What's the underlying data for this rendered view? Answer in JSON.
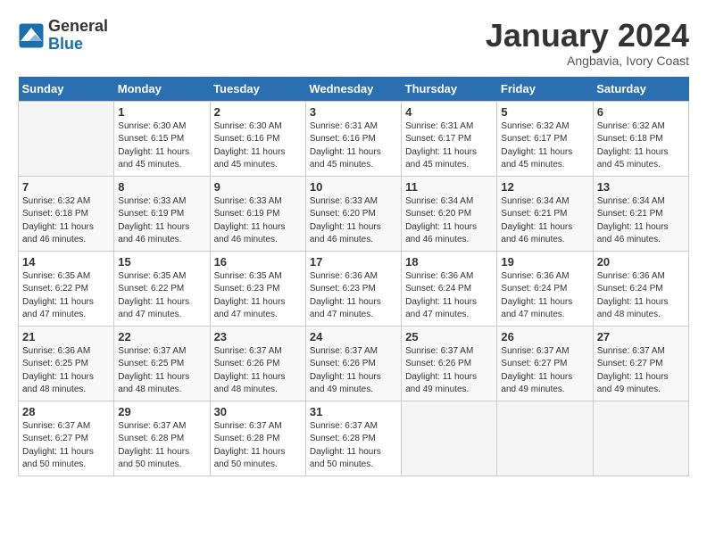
{
  "header": {
    "logo_line1": "General",
    "logo_line2": "Blue",
    "month": "January 2024",
    "location": "Angbavia, Ivory Coast"
  },
  "days_of_week": [
    "Sunday",
    "Monday",
    "Tuesday",
    "Wednesday",
    "Thursday",
    "Friday",
    "Saturday"
  ],
  "weeks": [
    [
      {
        "day": "",
        "info": ""
      },
      {
        "day": "1",
        "info": "Sunrise: 6:30 AM\nSunset: 6:15 PM\nDaylight: 11 hours\nand 45 minutes."
      },
      {
        "day": "2",
        "info": "Sunrise: 6:30 AM\nSunset: 6:16 PM\nDaylight: 11 hours\nand 45 minutes."
      },
      {
        "day": "3",
        "info": "Sunrise: 6:31 AM\nSunset: 6:16 PM\nDaylight: 11 hours\nand 45 minutes."
      },
      {
        "day": "4",
        "info": "Sunrise: 6:31 AM\nSunset: 6:17 PM\nDaylight: 11 hours\nand 45 minutes."
      },
      {
        "day": "5",
        "info": "Sunrise: 6:32 AM\nSunset: 6:17 PM\nDaylight: 11 hours\nand 45 minutes."
      },
      {
        "day": "6",
        "info": "Sunrise: 6:32 AM\nSunset: 6:18 PM\nDaylight: 11 hours\nand 45 minutes."
      }
    ],
    [
      {
        "day": "7",
        "info": "Sunrise: 6:32 AM\nSunset: 6:18 PM\nDaylight: 11 hours\nand 46 minutes."
      },
      {
        "day": "8",
        "info": "Sunrise: 6:33 AM\nSunset: 6:19 PM\nDaylight: 11 hours\nand 46 minutes."
      },
      {
        "day": "9",
        "info": "Sunrise: 6:33 AM\nSunset: 6:19 PM\nDaylight: 11 hours\nand 46 minutes."
      },
      {
        "day": "10",
        "info": "Sunrise: 6:33 AM\nSunset: 6:20 PM\nDaylight: 11 hours\nand 46 minutes."
      },
      {
        "day": "11",
        "info": "Sunrise: 6:34 AM\nSunset: 6:20 PM\nDaylight: 11 hours\nand 46 minutes."
      },
      {
        "day": "12",
        "info": "Sunrise: 6:34 AM\nSunset: 6:21 PM\nDaylight: 11 hours\nand 46 minutes."
      },
      {
        "day": "13",
        "info": "Sunrise: 6:34 AM\nSunset: 6:21 PM\nDaylight: 11 hours\nand 46 minutes."
      }
    ],
    [
      {
        "day": "14",
        "info": "Sunrise: 6:35 AM\nSunset: 6:22 PM\nDaylight: 11 hours\nand 47 minutes."
      },
      {
        "day": "15",
        "info": "Sunrise: 6:35 AM\nSunset: 6:22 PM\nDaylight: 11 hours\nand 47 minutes."
      },
      {
        "day": "16",
        "info": "Sunrise: 6:35 AM\nSunset: 6:23 PM\nDaylight: 11 hours\nand 47 minutes."
      },
      {
        "day": "17",
        "info": "Sunrise: 6:36 AM\nSunset: 6:23 PM\nDaylight: 11 hours\nand 47 minutes."
      },
      {
        "day": "18",
        "info": "Sunrise: 6:36 AM\nSunset: 6:24 PM\nDaylight: 11 hours\nand 47 minutes."
      },
      {
        "day": "19",
        "info": "Sunrise: 6:36 AM\nSunset: 6:24 PM\nDaylight: 11 hours\nand 47 minutes."
      },
      {
        "day": "20",
        "info": "Sunrise: 6:36 AM\nSunset: 6:24 PM\nDaylight: 11 hours\nand 48 minutes."
      }
    ],
    [
      {
        "day": "21",
        "info": "Sunrise: 6:36 AM\nSunset: 6:25 PM\nDaylight: 11 hours\nand 48 minutes."
      },
      {
        "day": "22",
        "info": "Sunrise: 6:37 AM\nSunset: 6:25 PM\nDaylight: 11 hours\nand 48 minutes."
      },
      {
        "day": "23",
        "info": "Sunrise: 6:37 AM\nSunset: 6:26 PM\nDaylight: 11 hours\nand 48 minutes."
      },
      {
        "day": "24",
        "info": "Sunrise: 6:37 AM\nSunset: 6:26 PM\nDaylight: 11 hours\nand 49 minutes."
      },
      {
        "day": "25",
        "info": "Sunrise: 6:37 AM\nSunset: 6:26 PM\nDaylight: 11 hours\nand 49 minutes."
      },
      {
        "day": "26",
        "info": "Sunrise: 6:37 AM\nSunset: 6:27 PM\nDaylight: 11 hours\nand 49 minutes."
      },
      {
        "day": "27",
        "info": "Sunrise: 6:37 AM\nSunset: 6:27 PM\nDaylight: 11 hours\nand 49 minutes."
      }
    ],
    [
      {
        "day": "28",
        "info": "Sunrise: 6:37 AM\nSunset: 6:27 PM\nDaylight: 11 hours\nand 50 minutes."
      },
      {
        "day": "29",
        "info": "Sunrise: 6:37 AM\nSunset: 6:28 PM\nDaylight: 11 hours\nand 50 minutes."
      },
      {
        "day": "30",
        "info": "Sunrise: 6:37 AM\nSunset: 6:28 PM\nDaylight: 11 hours\nand 50 minutes."
      },
      {
        "day": "31",
        "info": "Sunrise: 6:37 AM\nSunset: 6:28 PM\nDaylight: 11 hours\nand 50 minutes."
      },
      {
        "day": "",
        "info": ""
      },
      {
        "day": "",
        "info": ""
      },
      {
        "day": "",
        "info": ""
      }
    ]
  ]
}
